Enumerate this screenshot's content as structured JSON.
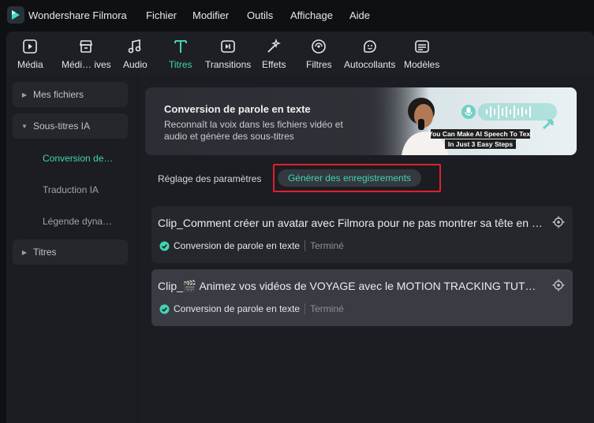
{
  "app": {
    "name": "Wondershare Filmora"
  },
  "menu": [
    "Fichier",
    "Modifier",
    "Outils",
    "Affichage",
    "Aide"
  ],
  "toolbar": [
    {
      "label": "Média",
      "icon": "media-icon"
    },
    {
      "label": "Médi… ives",
      "icon": "stock-media-icon"
    },
    {
      "label": "Audio",
      "icon": "audio-icon"
    },
    {
      "label": "Titres",
      "icon": "titles-icon",
      "active": true
    },
    {
      "label": "Transitions",
      "icon": "transitions-icon"
    },
    {
      "label": "Effets",
      "icon": "effects-icon"
    },
    {
      "label": "Filtres",
      "icon": "filters-icon"
    },
    {
      "label": "Autocollants",
      "icon": "stickers-icon"
    },
    {
      "label": "Modèles",
      "icon": "templates-icon"
    }
  ],
  "sidebar": {
    "groups": [
      {
        "label": "Mes fichiers",
        "expanded": false
      },
      {
        "label": "Sous-titres IA",
        "expanded": true
      },
      {
        "label": "Titres",
        "expanded": false
      }
    ],
    "subitems": [
      {
        "label": "Conversion de…",
        "active": true
      },
      {
        "label": "Traduction IA"
      },
      {
        "label": "Légende dyna…"
      }
    ]
  },
  "banner": {
    "title": "Conversion de parole en texte",
    "description": "Reconnaît la voix dans les fichiers vidéo et audio et génère des sous-titres",
    "promo_line1": "You Can Make AI Speech To Text",
    "promo_line2": "In Just  3 Easy Steps"
  },
  "tabs": {
    "settings": "Réglage des paramètres",
    "generate": "Générer des enregistrements"
  },
  "records": [
    {
      "title": "Clip_Comment créer un avatar avec Filmora pour ne pas montrer sa tête en vi…",
      "type": "Conversion de parole en texte",
      "status": "Terminé"
    },
    {
      "title": "Clip_🎬 Animez vos vidéos de VOYAGE avec le MOTION TRACKING  TUTO M…",
      "type": "Conversion de parole en texte",
      "status": "Terminé"
    }
  ],
  "colors": {
    "accent": "#43d2b3",
    "highlight_box": "#e0202e",
    "background": "#0f1013",
    "panel": "#1b1d22"
  }
}
